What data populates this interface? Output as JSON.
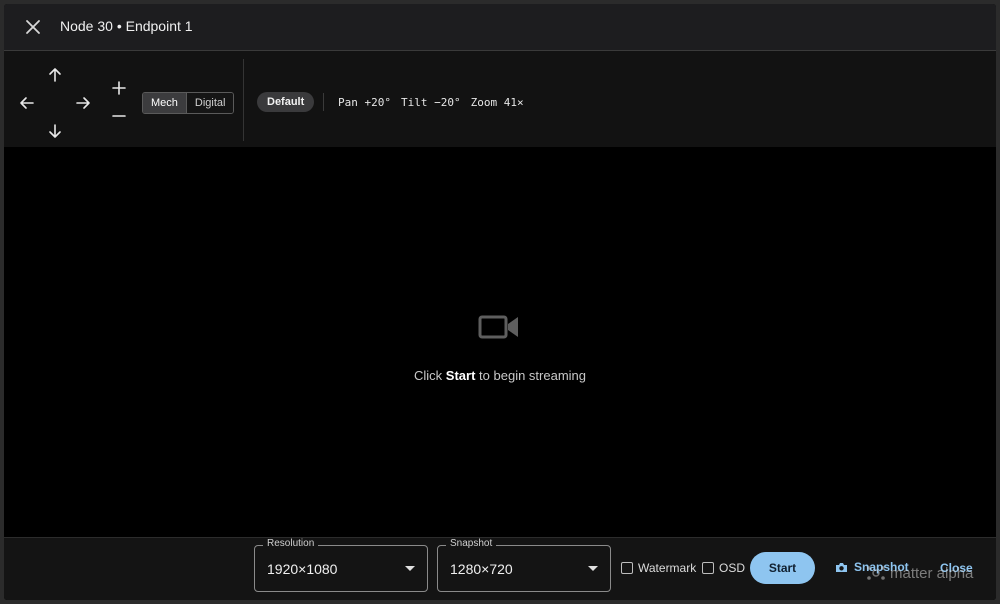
{
  "title": "Node 30 • Endpoint 1",
  "ptz": {
    "mode_options": [
      "Mech",
      "Digital"
    ],
    "mode_selected": "Mech",
    "preset": "Default",
    "pan": "Pan +20°",
    "tilt": "Tilt −20°",
    "zoom": "Zoom 41×"
  },
  "stream": {
    "hint_prefix": "Click",
    "hint_bold": "Start",
    "hint_suffix": "to begin streaming"
  },
  "footer": {
    "resolution_label": "Resolution",
    "resolution_value": "1920×1080",
    "snapshot_label": "Snapshot",
    "snapshot_value": "1280×720",
    "watermark_label": "Watermark",
    "osd_label": "OSD",
    "start_label": "Start",
    "snapshot_button": "Snapshot",
    "close_button": "Close"
  },
  "watermark_text": "matter alpha",
  "colors": {
    "accent": "#8ec5f0",
    "background": "#000000",
    "panel": "#141414"
  },
  "icons": [
    "close-icon",
    "arrow-up-icon",
    "arrow-left-icon",
    "arrow-right-icon",
    "arrow-down-icon",
    "plus-icon",
    "minus-icon",
    "video-camera-icon",
    "chevron-down-icon",
    "camera-icon"
  ]
}
